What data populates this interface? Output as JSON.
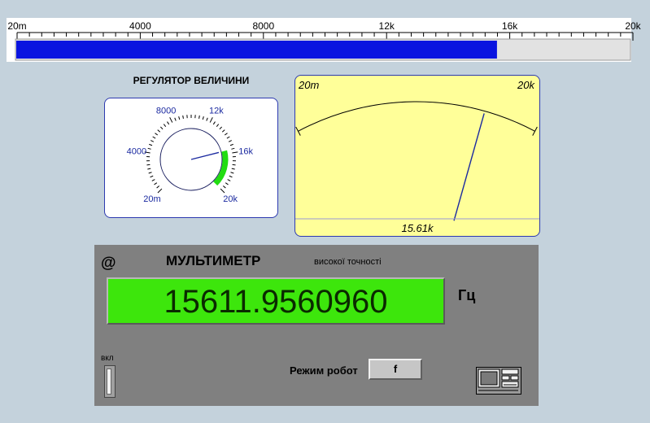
{
  "slider": {
    "ticks": [
      "20m",
      "4000",
      "8000",
      "12k",
      "16k",
      "20k"
    ],
    "value": 15612,
    "max": 20000,
    "fill_color": "#0a14e0"
  },
  "regulator": {
    "title": "РЕГУЛЯТОР ВЕЛИЧИНИ",
    "ticks": [
      "20m",
      "4000",
      "8000",
      "12k",
      "16k",
      "20k"
    ],
    "value": 15612,
    "max": 20000,
    "arc_color": "#22dd11"
  },
  "meter": {
    "min_label": "20m",
    "max_label": "20k",
    "value": 15612,
    "max": 20000,
    "readout": "15.61k",
    "background": "#ffff99"
  },
  "multimeter": {
    "at_symbol": "@",
    "title": "МУЛЬТИМЕТР",
    "subtitle": "високої точності",
    "value": "15611.9560960",
    "unit": "Гц",
    "power_label": "вкл",
    "mode_label": "Режим робот",
    "mode_value": "f",
    "display_color": "#3de60c",
    "device_icon": "oscilloscope-icon"
  }
}
